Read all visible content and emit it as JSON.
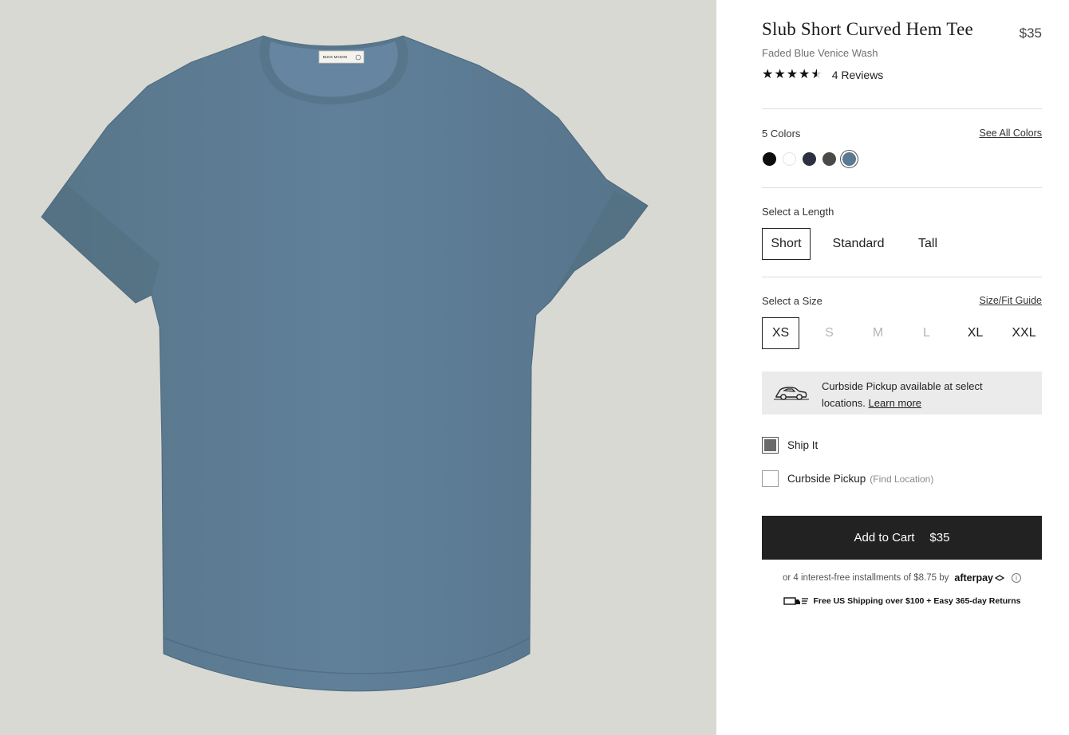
{
  "product": {
    "title": "Slub Short Curved Hem Tee",
    "price": "$35",
    "subtitle": "Faded Blue Venice Wash",
    "rating": 4.5,
    "reviews": "4 Reviews",
    "label_brand": "BUCK MASON"
  },
  "colors": {
    "count_label": "5 Colors",
    "see_all": "See All Colors",
    "swatches": [
      {
        "name": "black",
        "hex": "#0d0d0d",
        "selected": false
      },
      {
        "name": "white",
        "hex": "#ffffff",
        "selected": false
      },
      {
        "name": "navy",
        "hex": "#2b3140",
        "selected": false
      },
      {
        "name": "charcoal",
        "hex": "#4a4a46",
        "selected": false
      },
      {
        "name": "faded-blue",
        "hex": "#5b7990",
        "selected": true
      }
    ]
  },
  "length": {
    "label": "Select a Length",
    "options": [
      "Short",
      "Standard",
      "Tall"
    ],
    "selected": "Short"
  },
  "size": {
    "label": "Select a Size",
    "guide": "Size/Fit Guide",
    "options": [
      "XS",
      "S",
      "M",
      "L",
      "XL",
      "XXL"
    ],
    "selected": "XS",
    "unavailable": [
      "S",
      "M",
      "L"
    ]
  },
  "curbside": {
    "text": "Curbside Pickup available at select locations.",
    "learn_more": "Learn more"
  },
  "fulfillment": {
    "ship_it": "Ship It",
    "curbside_label": "Curbside Pickup",
    "curbside_hint": "(Find Location)"
  },
  "cart": {
    "label": "Add to Cart",
    "price": "$35"
  },
  "afterpay": {
    "text": "or 4 interest-free installments of $8.75 by",
    "brand": "afterpay",
    "info": "i"
  },
  "shipping": {
    "text": "Free US Shipping over $100 + Easy 365-day Returns"
  },
  "colors_theme": {
    "shirt": "#5d7c93",
    "background": "#d9d9d4",
    "button": "#222222"
  }
}
